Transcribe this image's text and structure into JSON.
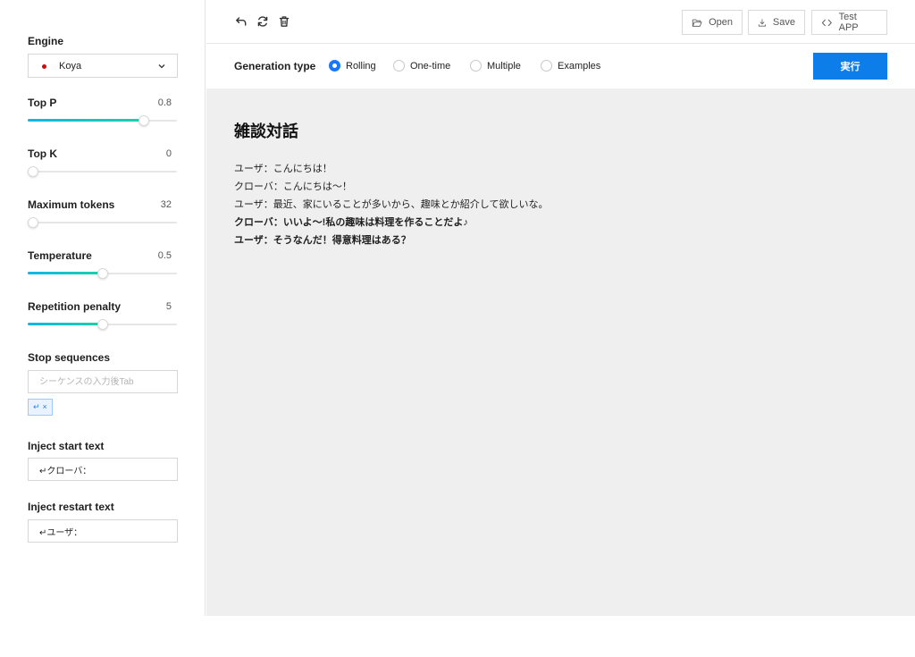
{
  "sidebar": {
    "engine": {
      "label": "Engine",
      "selected": "Koya",
      "dot_color": "#e00000"
    },
    "params": [
      {
        "label": "Top P",
        "value": "0.8",
        "level": 0.78
      },
      {
        "label": "Top K",
        "value": "0",
        "level": 0.0
      },
      {
        "label": "Maximum tokens",
        "value": "32",
        "level": 0.03
      },
      {
        "label": "Temperature",
        "value": "0.5",
        "level": 0.5
      },
      {
        "label": "Repetition penalty",
        "value": "5",
        "level": 0.5
      }
    ],
    "stop_sequences": {
      "label": "Stop sequences",
      "placeholder": "シーケンスの入力後Tab",
      "tags": [
        "↵"
      ]
    },
    "inject_start": {
      "label": "Inject start text",
      "value": "↵クローバ："
    },
    "inject_restart": {
      "label": "Inject restart text",
      "value": "↵ユーザ："
    }
  },
  "toolbar": {
    "open_label": "Open",
    "save_label": "Save",
    "test_app_label": "Test APP"
  },
  "generation": {
    "label": "Generation type",
    "options": [
      {
        "label": "Rolling",
        "checked": true
      },
      {
        "label": "One-time",
        "checked": false
      },
      {
        "label": "Multiple",
        "checked": false
      },
      {
        "label": "Examples",
        "checked": false
      }
    ],
    "run_label": "実行"
  },
  "content": {
    "title": "雑談対話",
    "lines": [
      {
        "text": "ユーザ：こんにちは！",
        "bold": false
      },
      {
        "text": "クローバ：こんにちは～！",
        "bold": false
      },
      {
        "text": "ユーザ：最近、家にいることが多いから、趣味とか紹介して欲しいな。",
        "bold": false
      },
      {
        "text": "クローバ：いいよ～!私の趣味は料理を作ることだよ♪",
        "bold": true
      },
      {
        "text": "ユーザ：そうなんだ！得意料理はある？",
        "bold": true
      }
    ]
  },
  "colors": {
    "accent": "#1677ff",
    "run_button": "#0d7dea",
    "slider_start": "#0eb7e6",
    "slider_end": "#1dd1a8"
  }
}
